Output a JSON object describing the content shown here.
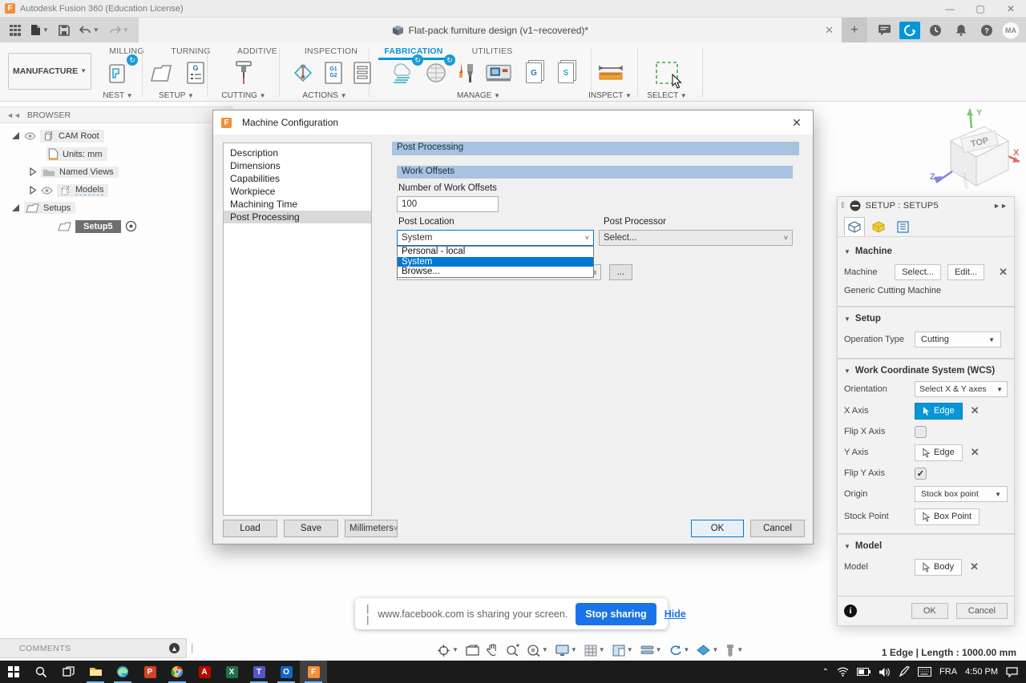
{
  "titlebar": {
    "app_title": "Autodesk Fusion 360 (Education License)"
  },
  "appbar": {
    "document_title": "Flat-pack furniture design (v1~recovered)*",
    "avatar_initials": "MA"
  },
  "ribbon": {
    "manufacture_label": "MANUFACTURE",
    "tabs": [
      {
        "label": "MILLING"
      },
      {
        "label": "TURNING"
      },
      {
        "label": "ADDITIVE"
      },
      {
        "label": "INSPECTION"
      },
      {
        "label": "FABRICATION"
      },
      {
        "label": "UTILITIES"
      }
    ],
    "active_tab": "FABRICATION",
    "groups": [
      {
        "label": "NEST"
      },
      {
        "label": "SETUP"
      },
      {
        "label": "CUTTING"
      },
      {
        "label": "ACTIONS"
      },
      {
        "label": "MANAGE"
      },
      {
        "label": "INSPECT"
      },
      {
        "label": "SELECT"
      }
    ],
    "icon_glyphs": {
      "g_doc": "G",
      "s_doc": "S",
      "g1": "G1",
      "g2": "G2"
    }
  },
  "browser": {
    "header": "BROWSER",
    "cam_root": "CAM Root",
    "units": "Units: mm",
    "named_views": "Named Views",
    "models": "Models",
    "setups": "Setups",
    "setup5": "Setup5"
  },
  "viewcube": {
    "top": "TOP",
    "x": "X",
    "y": "Y",
    "z": "Z"
  },
  "dialog": {
    "title": "Machine Configuration",
    "nav": [
      {
        "label": "Description"
      },
      {
        "label": "Dimensions"
      },
      {
        "label": "Capabilities"
      },
      {
        "label": "Workpiece"
      },
      {
        "label": "Machining Time"
      },
      {
        "label": "Post Processing"
      }
    ],
    "selected_nav": "Post Processing",
    "header_bar": "Post Processing",
    "work_offsets_header": "Work Offsets",
    "number_label": "Number of Work Offsets",
    "number_value": "100",
    "post_location_label": "Post Location",
    "post_location_value": "System",
    "options": [
      {
        "label": "Personal - local"
      },
      {
        "label": "System"
      },
      {
        "label": "Browse..."
      }
    ],
    "highlighted_option": "System",
    "post_processor_label": "Post Processor",
    "post_processor_value": "Select...",
    "browse_button": "...",
    "load": "Load",
    "save": "Save",
    "units_value": "Millimeters",
    "ok": "OK",
    "cancel": "Cancel"
  },
  "setup_panel": {
    "title": "SETUP : SETUP5",
    "machine": {
      "title": "Machine",
      "label": "Machine",
      "select": "Select...",
      "edit": "Edit...",
      "name": "Generic Cutting Machine"
    },
    "setup": {
      "title": "Setup",
      "operation_label": "Operation Type",
      "operation_value": "Cutting"
    },
    "wcs": {
      "title": "Work Coordinate System (WCS)",
      "orientation_label": "Orientation",
      "orientation_value": "Select X & Y axes",
      "x_axis_label": "X Axis",
      "x_axis_value": "Edge",
      "flip_x_label": "Flip X Axis",
      "flip_x_checked": false,
      "y_axis_label": "Y Axis",
      "y_axis_value": "Edge",
      "flip_y_label": "Flip Y Axis",
      "flip_y_checked": true,
      "origin_label": "Origin",
      "origin_value": "Stock box point",
      "stock_point_label": "Stock Point",
      "stock_point_value": "Box Point"
    },
    "model": {
      "title": "Model",
      "label": "Model",
      "value": "Body"
    },
    "ok": "OK",
    "cancel": "Cancel"
  },
  "status": {
    "selection_info": "1 Edge | Length : 1000.00 mm"
  },
  "share_bar": {
    "message": "www.facebook.com is sharing your screen.",
    "stop": "Stop sharing",
    "hide": "Hide"
  },
  "comments": {
    "label": "COMMENTS"
  },
  "taskbar": {
    "language": "FRA",
    "time": "4:50 PM",
    "apps": [
      {
        "name": "start",
        "open": false
      },
      {
        "name": "search",
        "open": false
      },
      {
        "name": "task-view",
        "open": false
      },
      {
        "name": "file-explorer",
        "open": true
      },
      {
        "name": "edge",
        "open": true
      },
      {
        "name": "powerpoint",
        "glyph": "P",
        "color": "#d04423",
        "open": false
      },
      {
        "name": "chrome",
        "open": true
      },
      {
        "name": "acrobat",
        "glyph": "A",
        "color": "#b30b00",
        "open": false
      },
      {
        "name": "excel",
        "glyph": "X",
        "color": "#1e7145",
        "open": false
      },
      {
        "name": "teams",
        "glyph": "T",
        "color": "#5059c9",
        "open": true
      },
      {
        "name": "outlook",
        "glyph": "O",
        "color": "#1565c0",
        "open": true
      },
      {
        "name": "fusion",
        "glyph": "F",
        "color": "#f18f3b",
        "open": true,
        "active": true
      }
    ]
  },
  "colors": {
    "fusion_blue": "#0696d7",
    "selection_blue": "#0078d7",
    "dialog_header": "#a7c3e0",
    "share_blue": "#1a73e8"
  }
}
